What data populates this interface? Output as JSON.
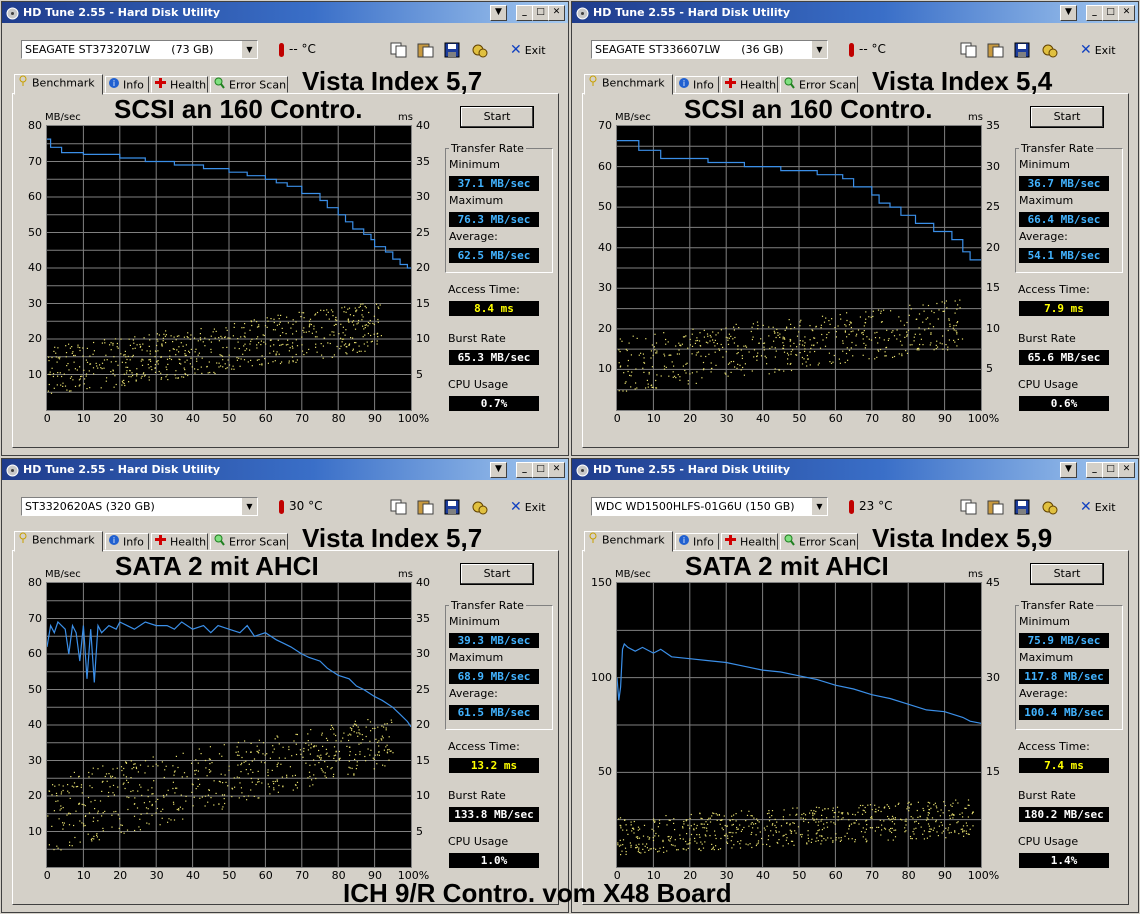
{
  "colors": {
    "plot_bg": "#000000",
    "grid": "#808080",
    "transfer_line": "#3b8fe8",
    "access_points": "#e8e070",
    "value_blue": "#42b3ff",
    "value_yellow": "#ffff00",
    "value_white": "#ffffff",
    "titlebar_start": "#1f3c8c",
    "titlebar_end": "#a6caf0"
  },
  "windows": [
    {
      "id": "w1",
      "title": "HD Tune 2.55 - Hard Disk Utility",
      "drive": "SEAGATE ST373207LW      (73 GB)",
      "temperature": "-- °C",
      "exit_label": "Exit",
      "tabs": [
        "Benchmark",
        "Info",
        "Health",
        "Error Scan"
      ],
      "vista_index": "Vista Index 5,7",
      "chart_title": "SCSI an 160 Contro.",
      "start_label": "Start",
      "units_left": "MB/sec",
      "units_right": "ms",
      "transfer_rate_label": "Transfer Rate",
      "minimum_label": "Minimum",
      "minimum": "37.1 MB/sec",
      "maximum_label": "Maximum",
      "maximum": "76.3 MB/sec",
      "average_label": "Average:",
      "average": "62.5 MB/sec",
      "access_time_label": "Access Time:",
      "access_time": "8.4 ms",
      "burst_rate_label": "Burst Rate",
      "burst_rate": "65.3 MB/sec",
      "cpu_usage_label": "CPU Usage",
      "cpu_usage": "0.7%"
    },
    {
      "id": "w2",
      "title": "HD Tune 2.55 - Hard Disk Utility",
      "drive": "SEAGATE ST336607LW      (36 GB)",
      "temperature": "-- °C",
      "exit_label": "Exit",
      "tabs": [
        "Benchmark",
        "Info",
        "Health",
        "Error Scan"
      ],
      "vista_index": "Vista Index 5,4",
      "chart_title": "SCSI an 160 Contro.",
      "start_label": "Start",
      "units_left": "MB/sec",
      "units_right": "ms",
      "transfer_rate_label": "Transfer Rate",
      "minimum_label": "Minimum",
      "minimum": "36.7 MB/sec",
      "maximum_label": "Maximum",
      "maximum": "66.4 MB/sec",
      "average_label": "Average:",
      "average": "54.1 MB/sec",
      "access_time_label": "Access Time:",
      "access_time": "7.9 ms",
      "burst_rate_label": "Burst Rate",
      "burst_rate": "65.6 MB/sec",
      "cpu_usage_label": "CPU Usage",
      "cpu_usage": "0.6%"
    },
    {
      "id": "w3",
      "title": "HD Tune 2.55 - Hard Disk Utility",
      "drive": "ST3320620AS (320 GB)",
      "temperature": "30 °C",
      "exit_label": "Exit",
      "tabs": [
        "Benchmark",
        "Info",
        "Health",
        "Error Scan"
      ],
      "vista_index": "Vista Index 5,7",
      "chart_title": "SATA 2 mit AHCI",
      "start_label": "Start",
      "units_left": "MB/sec",
      "units_right": "ms",
      "transfer_rate_label": "Transfer Rate",
      "minimum_label": "Minimum",
      "minimum": "39.3 MB/sec",
      "maximum_label": "Maximum",
      "maximum": "68.9 MB/sec",
      "average_label": "Average:",
      "average": "61.5 MB/sec",
      "access_time_label": "Access Time:",
      "access_time": "13.2 ms",
      "burst_rate_label": "Burst Rate",
      "burst_rate": "133.8 MB/sec",
      "cpu_usage_label": "CPU Usage",
      "cpu_usage": "1.0%"
    },
    {
      "id": "w4",
      "title": "HD Tune 2.55 - Hard Disk Utility",
      "drive": "WDC WD1500HLFS-01G6U (150 GB)",
      "temperature": "23 °C",
      "exit_label": "Exit",
      "tabs": [
        "Benchmark",
        "Info",
        "Health",
        "Error Scan"
      ],
      "vista_index": "Vista Index 5,9",
      "chart_title": "SATA 2 mit AHCI",
      "start_label": "Start",
      "units_left": "MB/sec",
      "units_right": "ms",
      "transfer_rate_label": "Transfer Rate",
      "minimum_label": "Minimum",
      "minimum": "75.9 MB/sec",
      "maximum_label": "Maximum",
      "maximum": "117.8 MB/sec",
      "average_label": "Average:",
      "average": "100.4 MB/sec",
      "access_time_label": "Access Time:",
      "access_time": "7.4 ms",
      "burst_rate_label": "Burst Rate",
      "burst_rate": "180.2 MB/sec",
      "cpu_usage_label": "CPU Usage",
      "cpu_usage": "1.4%"
    }
  ],
  "footer": "ICH 9/R  Contro. vom X48 Board",
  "chart_data": [
    {
      "type": "line",
      "chart": "w1",
      "x_ticks": [
        "0",
        "10",
        "20",
        "30",
        "40",
        "50",
        "60",
        "70",
        "80",
        "90",
        "100%"
      ],
      "y_ticks": [
        "10",
        "20",
        "30",
        "40",
        "50",
        "60",
        "70",
        "80"
      ],
      "y2_ticks": [
        "5",
        "10",
        "15",
        "20",
        "25",
        "30",
        "35",
        "40"
      ],
      "ylim": [
        0,
        80
      ],
      "y2lim": [
        0,
        40
      ],
      "grid": true,
      "series": [
        {
          "x": [
            0,
            1,
            1,
            4,
            4,
            10,
            10,
            20,
            20,
            27,
            27,
            35,
            35,
            43,
            43,
            50,
            50,
            55,
            55,
            60,
            60,
            63,
            63,
            66,
            66,
            70,
            70,
            75,
            75,
            77,
            77,
            80,
            80,
            82,
            82,
            84,
            84,
            87,
            87,
            89,
            89,
            90,
            90,
            93,
            93,
            95,
            95,
            97,
            97,
            99,
            99,
            100
          ],
          "y": [
            76.3,
            76.3,
            74,
            74,
            72.5,
            72.5,
            72,
            72,
            71,
            71,
            70,
            70,
            69,
            69,
            68,
            68,
            67,
            67,
            66,
            66,
            65,
            65,
            64,
            64,
            63,
            63,
            61,
            61,
            59,
            59,
            57,
            57,
            55,
            55,
            53,
            53,
            51,
            51,
            49.5,
            49.5,
            48,
            48,
            46,
            46,
            44.5,
            44.5,
            42.5,
            42.5,
            41,
            41,
            40,
            40
          ]
        }
      ],
      "points": {
        "x_range": [
          0,
          92
        ],
        "y_start_ms": [
          2,
          9
        ],
        "y_end_ms": [
          9,
          16
        ],
        "count": 650
      }
    },
    {
      "type": "line",
      "chart": "w2",
      "x_ticks": [
        "0",
        "10",
        "20",
        "30",
        "40",
        "50",
        "60",
        "70",
        "80",
        "90",
        "100%"
      ],
      "y_ticks": [
        "10",
        "20",
        "30",
        "40",
        "50",
        "60",
        "70"
      ],
      "y2_ticks": [
        "5",
        "10",
        "15",
        "20",
        "25",
        "30",
        "35"
      ],
      "ylim": [
        0,
        70
      ],
      "y2lim": [
        0,
        35
      ],
      "grid": true,
      "series": [
        {
          "x": [
            0,
            6,
            6,
            12,
            12,
            25,
            25,
            35,
            35,
            45,
            45,
            55,
            55,
            62,
            62,
            65,
            65,
            70,
            70,
            72,
            72,
            75,
            75,
            78,
            78,
            82,
            82,
            87,
            87,
            92,
            92,
            95,
            95,
            97,
            97,
            100
          ],
          "y": [
            66.4,
            66.4,
            64,
            64,
            62,
            62,
            61,
            61,
            60,
            60,
            59,
            59,
            58,
            58,
            57,
            57,
            55,
            55,
            53,
            53,
            51,
            51,
            50,
            50,
            48,
            48,
            46,
            46,
            44,
            44,
            42,
            42,
            39,
            39,
            37,
            37
          ]
        }
      ],
      "points": {
        "x_range": [
          0,
          95
        ],
        "y_start_ms": [
          2,
          9
        ],
        "y_end_ms": [
          8,
          14
        ],
        "count": 550
      }
    },
    {
      "type": "line",
      "chart": "w3",
      "x_ticks": [
        "0",
        "10",
        "20",
        "30",
        "40",
        "50",
        "60",
        "70",
        "80",
        "90",
        "100%"
      ],
      "y_ticks": [
        "10",
        "20",
        "30",
        "40",
        "50",
        "60",
        "70",
        "80"
      ],
      "y2_ticks": [
        "5",
        "10",
        "15",
        "20",
        "25",
        "30",
        "35",
        "40"
      ],
      "ylim": [
        0,
        80
      ],
      "y2lim": [
        0,
        40
      ],
      "grid": true,
      "series": [
        {
          "x": [
            0,
            1,
            2,
            3,
            5,
            6,
            7,
            8,
            9,
            10,
            11,
            12,
            13,
            14,
            15,
            17,
            19,
            20,
            22,
            24,
            27,
            30,
            33,
            35,
            37,
            40,
            43,
            45,
            47,
            50,
            53,
            55,
            57,
            60,
            63,
            65,
            67,
            70,
            72,
            75,
            77,
            80,
            83,
            85,
            87,
            90,
            92,
            95,
            97,
            99,
            100
          ],
          "y": [
            62,
            68,
            66,
            69,
            67,
            60,
            68,
            66,
            58,
            68,
            53,
            67,
            52,
            68,
            66,
            68,
            67,
            69,
            68,
            67,
            69,
            68,
            68,
            67,
            69,
            67,
            68,
            66,
            68,
            67,
            66,
            68,
            65,
            66,
            64,
            63,
            62,
            60,
            59,
            58,
            56,
            54,
            53,
            51,
            50,
            48,
            47,
            45,
            43,
            41,
            39.5
          ]
        }
      ],
      "points": {
        "x_range": [
          0,
          95
        ],
        "y_start_ms": [
          2,
          13
        ],
        "y_end_ms": [
          15,
          22
        ],
        "count": 600
      }
    },
    {
      "type": "line",
      "chart": "w4",
      "x_ticks": [
        "0",
        "10",
        "20",
        "30",
        "40",
        "50",
        "60",
        "70",
        "80",
        "90",
        "100%"
      ],
      "y_ticks": [
        "50",
        "100",
        "150"
      ],
      "y2_ticks": [
        "15",
        "30",
        "45"
      ],
      "ylim": [
        0,
        150
      ],
      "y2lim": [
        0,
        45
      ],
      "grid": true,
      "series": [
        {
          "x": [
            0,
            0.5,
            1,
            1.5,
            2,
            3,
            5,
            7,
            10,
            12,
            15,
            20,
            25,
            30,
            35,
            40,
            45,
            50,
            55,
            60,
            65,
            70,
            75,
            80,
            85,
            90,
            95,
            97,
            100
          ],
          "y": [
            100,
            88,
            95,
            115,
            117.8,
            116,
            114,
            116,
            113,
            115,
            111,
            110,
            109,
            108,
            106,
            104,
            103,
            101,
            99,
            96,
            94,
            91,
            89,
            86,
            83,
            82,
            79,
            77,
            75.9
          ]
        }
      ],
      "points": {
        "x_range": [
          0,
          98
        ],
        "y_start_ms": [
          2,
          8
        ],
        "y_end_ms": [
          5,
          11
        ],
        "count": 650
      }
    }
  ]
}
